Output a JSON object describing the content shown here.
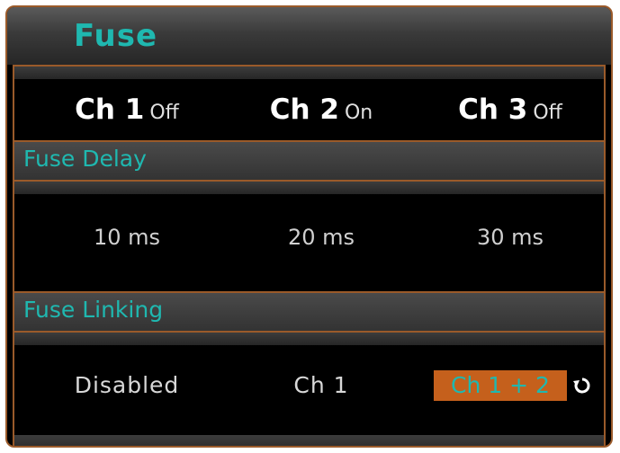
{
  "title": "Fuse",
  "channels": [
    {
      "label": "Ch 1",
      "state": "Off"
    },
    {
      "label": "Ch 2",
      "state": "On"
    },
    {
      "label": "Ch 3",
      "state": "Off"
    }
  ],
  "fuse_delay": {
    "label": "Fuse Delay",
    "values": [
      "10 ms",
      "20 ms",
      "30 ms"
    ]
  },
  "fuse_linking": {
    "label": "Fuse Linking",
    "values": [
      "Disabled",
      "Ch 1",
      "Ch 1 + 2"
    ],
    "selected_icon": "cycle-arrow-icon"
  },
  "colors": {
    "accent": "#1fb8b0",
    "border": "#9a5a2a",
    "selected_bg": "#c5601c"
  }
}
